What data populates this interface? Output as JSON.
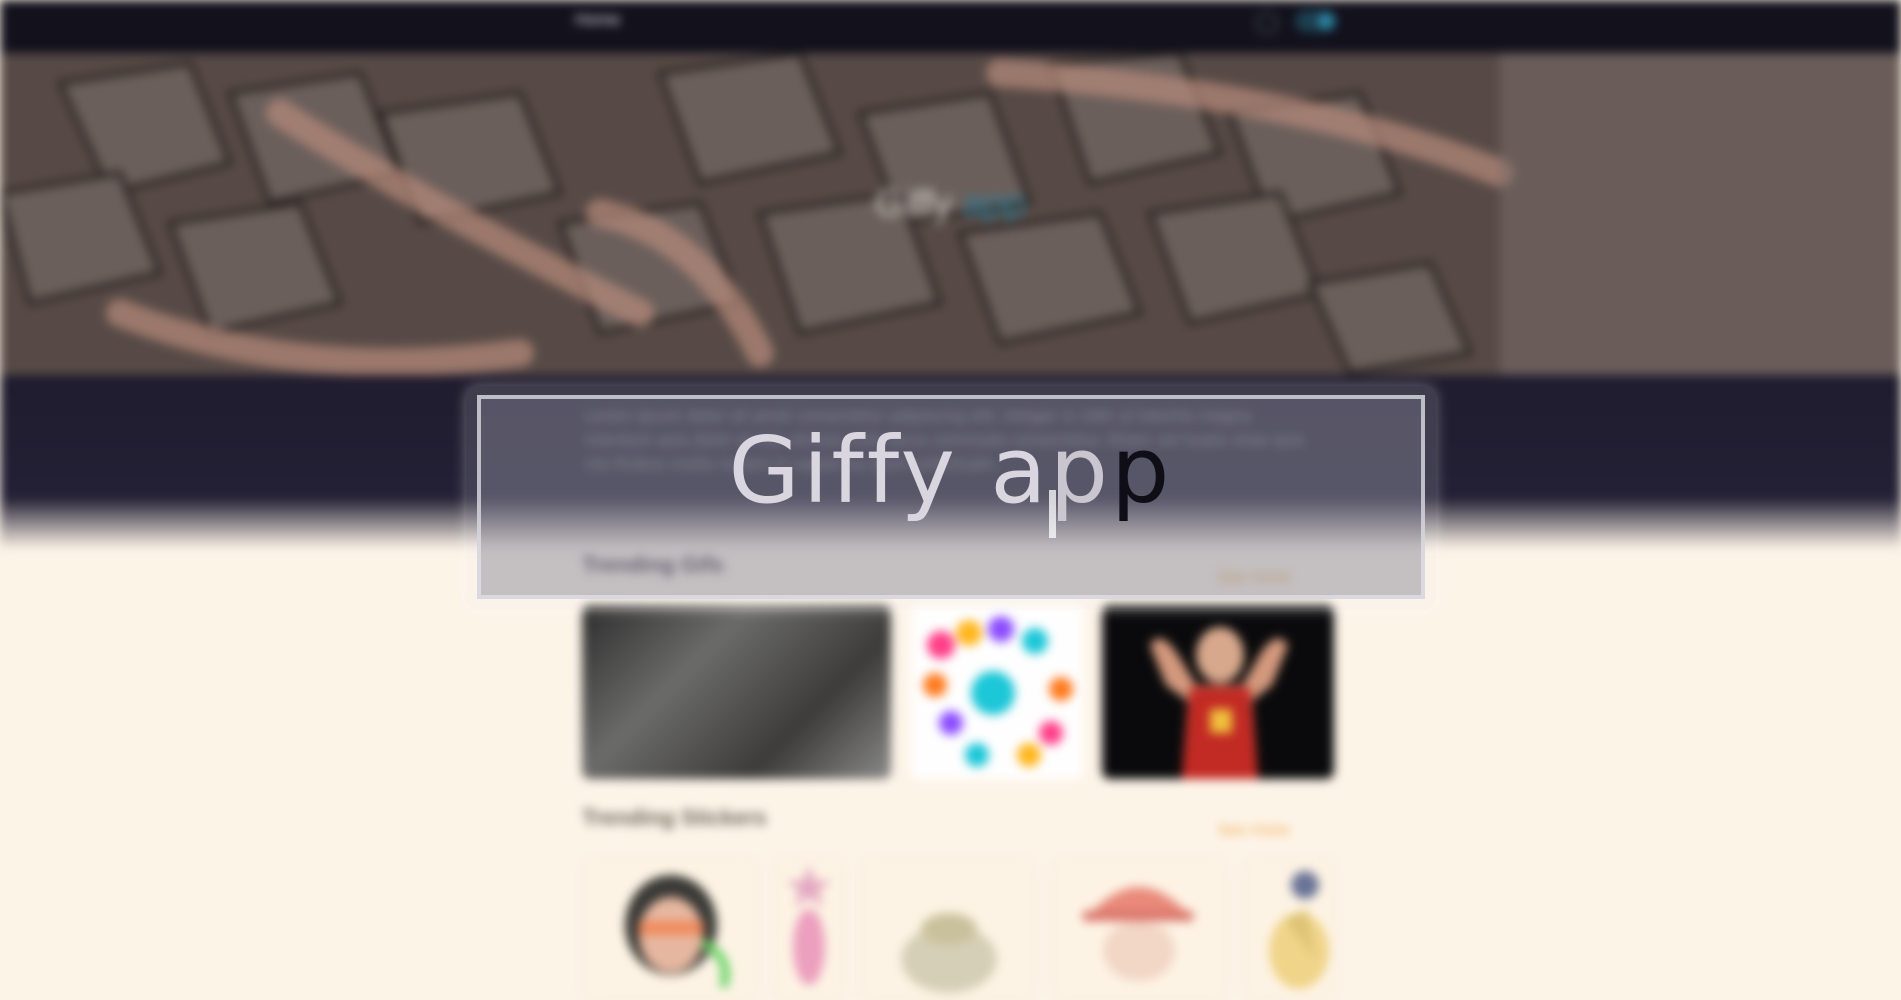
{
  "nav": {
    "home_label": "Home",
    "search_icon": "search-icon",
    "theme_toggle": "toggle-switch"
  },
  "hero": {
    "title_main": "Giffy",
    "title_accent": "app",
    "accent_color": "#2d7c95"
  },
  "intro": {
    "text": "Lorem ipsum dolor sit amet consectetur adipiscing elit. Integer in nibh ut lobortis magna interdum quis dolor et nisi ultrices nulla lacus commodo consectetur. Etiam vel turpis vitae quis nisi finibus mollis nullam in sapien eu enim sollicitudin."
  },
  "trending_gifs": {
    "heading": "Trending Gifs",
    "see_more": "See more"
  },
  "trending_stickers": {
    "heading": "Trending Stickers",
    "see_more": "See more"
  },
  "modal": {
    "title_part1": "Giffy a",
    "title_part2": "p",
    "title_part3": "p"
  },
  "colors": {
    "nav_bg": "#12111c",
    "page_bg": "#fdf4e8",
    "see_more": "#efa43c"
  }
}
